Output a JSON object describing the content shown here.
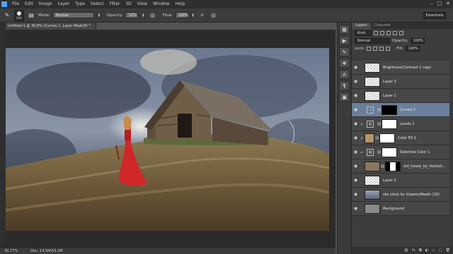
{
  "menu": [
    "File",
    "Edit",
    "Image",
    "Layer",
    "Type",
    "Select",
    "Filter",
    "3D",
    "View",
    "Window",
    "Help"
  ],
  "window_controls": [
    "–",
    "□",
    "✕"
  ],
  "options": {
    "brush_size": "204",
    "mode_label": "Mode:",
    "mode_value": "Normal",
    "opacity_label": "Opacity:",
    "opacity_value": "12%",
    "flow_label": "Flow:",
    "flow_value": "100%"
  },
  "workspace": "Essentials",
  "document_tab": "Untitled-1 @ 30.8% (Curves 1, Layer Mask/8) *",
  "status": {
    "zoom": "30.77%",
    "doc": "Doc: 14.5M/55.2M"
  },
  "panel": {
    "tabs": [
      "Layers",
      "Channels"
    ],
    "filter_kind": "Kind",
    "blend_mode": "Normal",
    "opacity_label": "Opacity:",
    "opacity_value": "100%",
    "lock_label": "Lock:",
    "fill_label": "Fill:",
    "fill_value": "100%"
  },
  "layers": [
    {
      "name": "Brightness/Contrast 1 copy"
    },
    {
      "name": "Layer 3"
    },
    {
      "name": "Layer 1"
    },
    {
      "name": "Curves 1"
    },
    {
      "name": "Levels 1"
    },
    {
      "name": "Color Fill 1"
    },
    {
      "name": "Selective Color 1"
    },
    {
      "name": "old_house_by_ilexlock..."
    },
    {
      "name": "Layer 2"
    },
    {
      "name": "sky stock by InkpenoMaath (10)"
    },
    {
      "name": "Background"
    }
  ],
  "colors": {
    "accent": "#4aa3ff",
    "selected_layer": "#6b7f9a",
    "dress_red": "#d0272a",
    "color_fill_swatch": "#b8936a"
  },
  "icons": {
    "eye": "eye-icon",
    "chain": "chain-link-icon"
  }
}
